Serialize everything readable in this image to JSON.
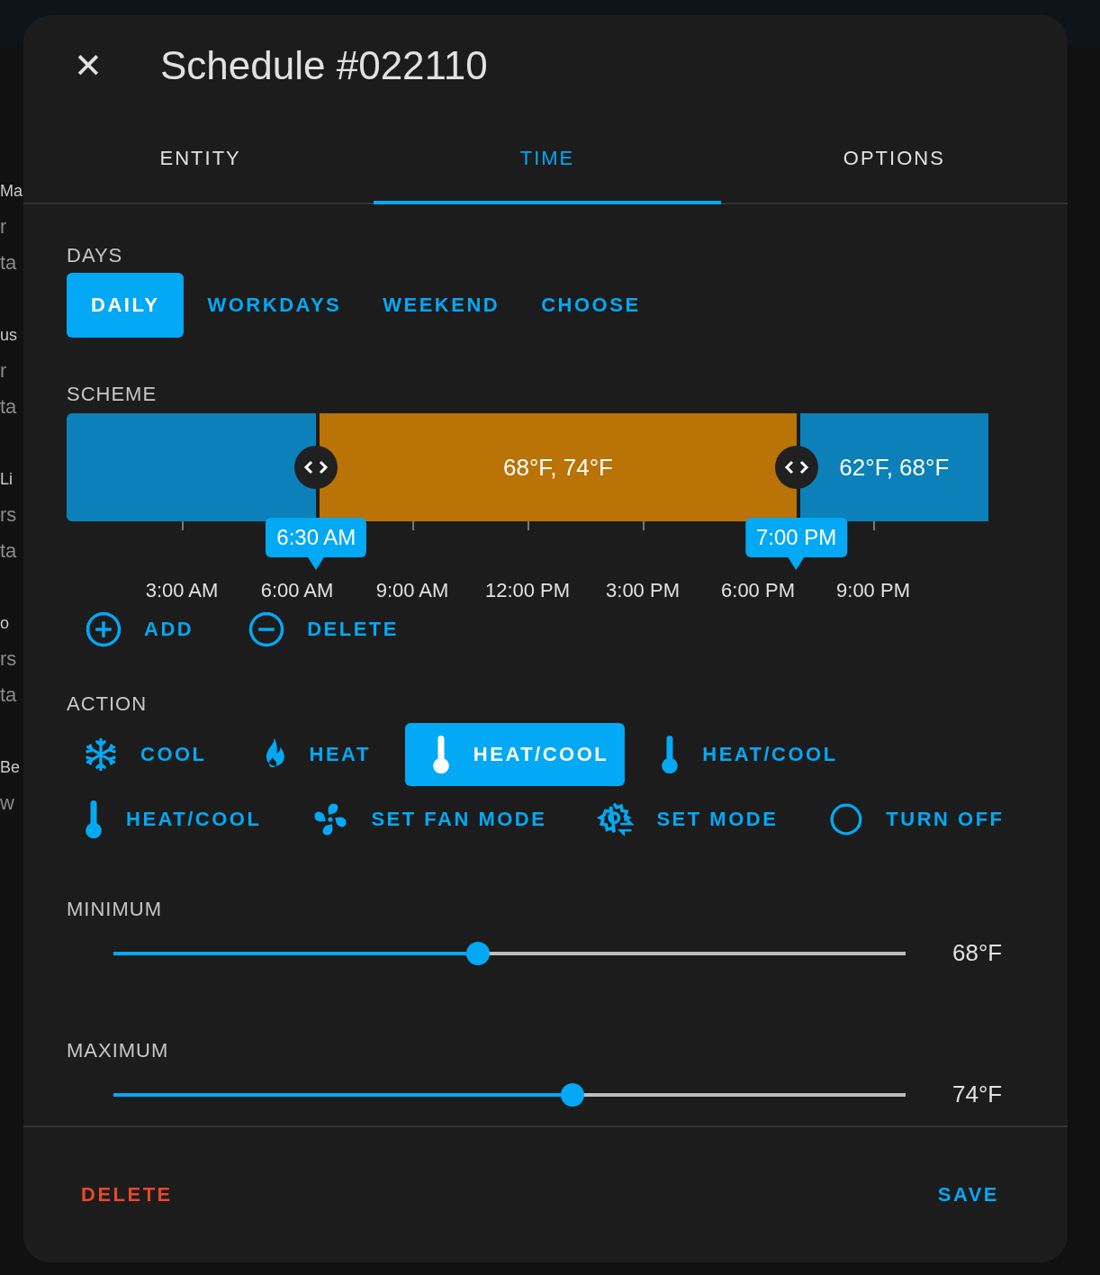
{
  "background_page": {
    "items": [
      {
        "title": "Ma",
        "lines": [
          "r",
          "ta"
        ]
      },
      {
        "title": "us",
        "lines": [
          "r",
          "ta"
        ]
      },
      {
        "title": "Li",
        "lines": [
          "rs",
          "ta"
        ]
      },
      {
        "title": "o",
        "lines": [
          "rs",
          "ta"
        ]
      },
      {
        "title": "Be",
        "lines": [
          "w"
        ]
      }
    ]
  },
  "dialog": {
    "close": "✕",
    "title": "Schedule #022110",
    "tabs": [
      {
        "label": "ENTITY",
        "selected": false
      },
      {
        "label": "TIME",
        "selected": true
      },
      {
        "label": "OPTIONS",
        "selected": false
      }
    ],
    "days": {
      "label": "DAYS",
      "options": [
        {
          "label": "DAILY",
          "selected": true
        },
        {
          "label": "WORKDAYS",
          "selected": false
        },
        {
          "label": "WEEKEND",
          "selected": false
        },
        {
          "label": "CHOOSE",
          "selected": false
        }
      ]
    },
    "scheme": {
      "label": "SCHEME",
      "slots": [
        {
          "color": "#0b80b9"
        },
        {
          "label": "68°F, 74°F",
          "color": "#b97306"
        },
        {
          "label": "62°F, 68°F",
          "color": "#0b80b9"
        }
      ],
      "handles": [
        {
          "time": "6:30 AM"
        },
        {
          "time": "7:00 PM"
        }
      ],
      "ticks": [
        "3:00 AM",
        "6:00 AM",
        "9:00 AM",
        "12:00 PM",
        "3:00 PM",
        "6:00 PM",
        "9:00 PM"
      ],
      "buttons": [
        {
          "kind": "add",
          "label": "ADD"
        },
        {
          "kind": "delete",
          "label": "DELETE"
        }
      ]
    },
    "action": {
      "label": "ACTION",
      "options": [
        {
          "kind": "snowflake",
          "label": "COOL",
          "selected": false
        },
        {
          "kind": "fire",
          "label": "HEAT",
          "selected": false
        },
        {
          "kind": "thermometer",
          "label": "HEAT/COOL",
          "selected": true
        },
        {
          "kind": "thermometer",
          "label": "HEAT/COOL",
          "selected": false
        },
        {
          "kind": "thermometer",
          "label": "HEAT/COOL",
          "selected": false
        },
        {
          "kind": "fan",
          "label": "SET FAN MODE",
          "selected": false
        },
        {
          "kind": "gear",
          "label": "SET MODE",
          "selected": false
        },
        {
          "kind": "circle",
          "label": "TURN OFF",
          "selected": false
        }
      ]
    },
    "sliders": [
      {
        "label": "MINIMUM",
        "level": 0.46,
        "reading": "68°F"
      },
      {
        "label": "MAXIMUM",
        "level": 0.58,
        "reading": "74°F"
      }
    ],
    "footer": {
      "delete": "DELETE",
      "save": "SAVE"
    }
  }
}
